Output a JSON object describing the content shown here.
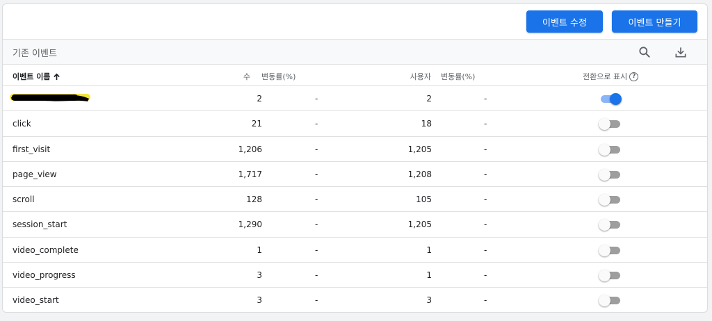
{
  "toolbar": {
    "edit_label": "이벤트 수정",
    "create_label": "이벤트 만들기"
  },
  "section": {
    "title": "기존 이벤트"
  },
  "columns": {
    "name": "이벤트 이름",
    "count": "수",
    "count_change": "변동률(%)",
    "users": "사용자",
    "users_change": "변동률(%)",
    "conversion": "전환으로 표시"
  },
  "rows": [
    {
      "name": "",
      "name_redacted": true,
      "count": "2",
      "count_change": "-",
      "users": "2",
      "users_change": "-",
      "conversion": true
    },
    {
      "name": "click",
      "count": "21",
      "count_change": "-",
      "users": "18",
      "users_change": "-",
      "conversion": false
    },
    {
      "name": "first_visit",
      "count": "1,206",
      "count_change": "-",
      "users": "1,205",
      "users_change": "-",
      "conversion": false
    },
    {
      "name": "page_view",
      "count": "1,717",
      "count_change": "-",
      "users": "1,208",
      "users_change": "-",
      "conversion": false
    },
    {
      "name": "scroll",
      "count": "128",
      "count_change": "-",
      "users": "105",
      "users_change": "-",
      "conversion": false
    },
    {
      "name": "session_start",
      "count": "1,290",
      "count_change": "-",
      "users": "1,205",
      "users_change": "-",
      "conversion": false
    },
    {
      "name": "video_complete",
      "count": "1",
      "count_change": "-",
      "users": "1",
      "users_change": "-",
      "conversion": false
    },
    {
      "name": "video_progress",
      "count": "3",
      "count_change": "-",
      "users": "1",
      "users_change": "-",
      "conversion": false
    },
    {
      "name": "video_start",
      "count": "3",
      "count_change": "-",
      "users": "3",
      "users_change": "-",
      "conversion": false
    }
  ],
  "colors": {
    "accent": "#1a73e8",
    "toggle_on_track": "#8ab4f8",
    "toggle_off_track": "#9e9e9e"
  },
  "icons": {
    "search": "search-icon",
    "download": "download-icon",
    "sort": "arrow-up-icon",
    "help": "help-icon"
  }
}
